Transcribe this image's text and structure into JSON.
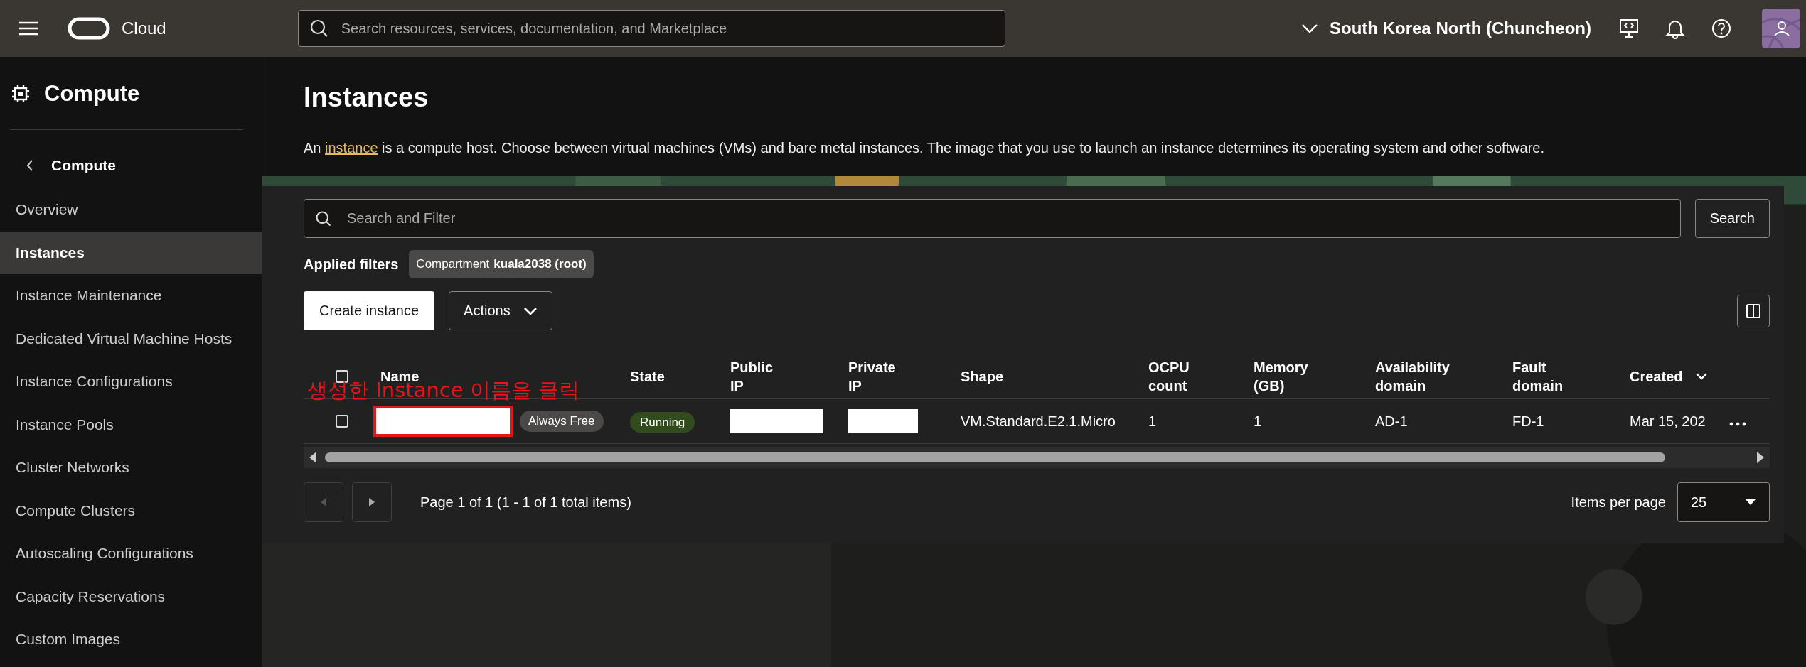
{
  "top_bar": {
    "brand": "Cloud",
    "search": {
      "placeholder": "Search resources, services, documentation, and Marketplace"
    },
    "region": "South Korea North (Chuncheon)"
  },
  "sidebar": {
    "title": "Compute",
    "back_label": "Compute",
    "items": [
      {
        "label": "Overview",
        "selected": false
      },
      {
        "label": "Instances",
        "selected": true
      },
      {
        "label": "Instance Maintenance",
        "selected": false
      },
      {
        "label": "Dedicated Virtual Machine Hosts",
        "selected": false
      },
      {
        "label": "Instance Configurations",
        "selected": false
      },
      {
        "label": "Instance Pools",
        "selected": false
      },
      {
        "label": "Cluster Networks",
        "selected": false
      },
      {
        "label": "Compute Clusters",
        "selected": false
      },
      {
        "label": "Autoscaling Configurations",
        "selected": false
      },
      {
        "label": "Capacity Reservations",
        "selected": false
      },
      {
        "label": "Custom Images",
        "selected": false
      }
    ]
  },
  "page": {
    "title": "Instances",
    "description": {
      "before": "An ",
      "link": "instance",
      "after": " is a compute host. Choose between virtual machines (VMs) and bare metal instances. The image that you use to launch an instance determines its operating system and other software."
    }
  },
  "filter": {
    "search": {
      "placeholder": "Search and Filter"
    },
    "search_button": "Search",
    "applied_label": "Applied filters",
    "chip": {
      "label": "Compartment",
      "value": "kuala2038 (root)"
    }
  },
  "toolbar": {
    "create_button": "Create instance",
    "actions_button": "Actions"
  },
  "table": {
    "select_all": {
      "checked": false
    },
    "columns": [
      {
        "label": "Name",
        "sorted": false
      },
      {
        "label": "State",
        "sorted": false
      },
      {
        "label": "Public IP",
        "sorted": false
      },
      {
        "label": "Private IP",
        "sorted": false
      },
      {
        "label": "Shape",
        "sorted": false
      },
      {
        "label": "OCPU count",
        "sorted": false
      },
      {
        "label": "Memory (GB)",
        "sorted": false
      },
      {
        "label": "Availability domain",
        "sorted": false
      },
      {
        "label": "Fault domain",
        "sorted": false
      },
      {
        "label": "Created",
        "sorted": true
      }
    ],
    "rows": [
      {
        "checked": false,
        "badge": "Always Free",
        "state": "Running",
        "shape": "VM.Standard.E2.1.Micro",
        "ocpu": "1",
        "memory": "1",
        "availability_domain": "AD-1",
        "fault_domain": "FD-1",
        "created": "Mar 15, 202"
      }
    ]
  },
  "annotation": {
    "text": "생성한 Instance 이름을 클릭"
  },
  "pagination": {
    "previous": {
      "disabled": true
    },
    "next": {
      "disabled": false
    },
    "summary": "Page 1 of 1 (1 - 1 of 1 total items)",
    "items_per_page": {
      "label": "Items per page",
      "value": "25"
    }
  }
}
